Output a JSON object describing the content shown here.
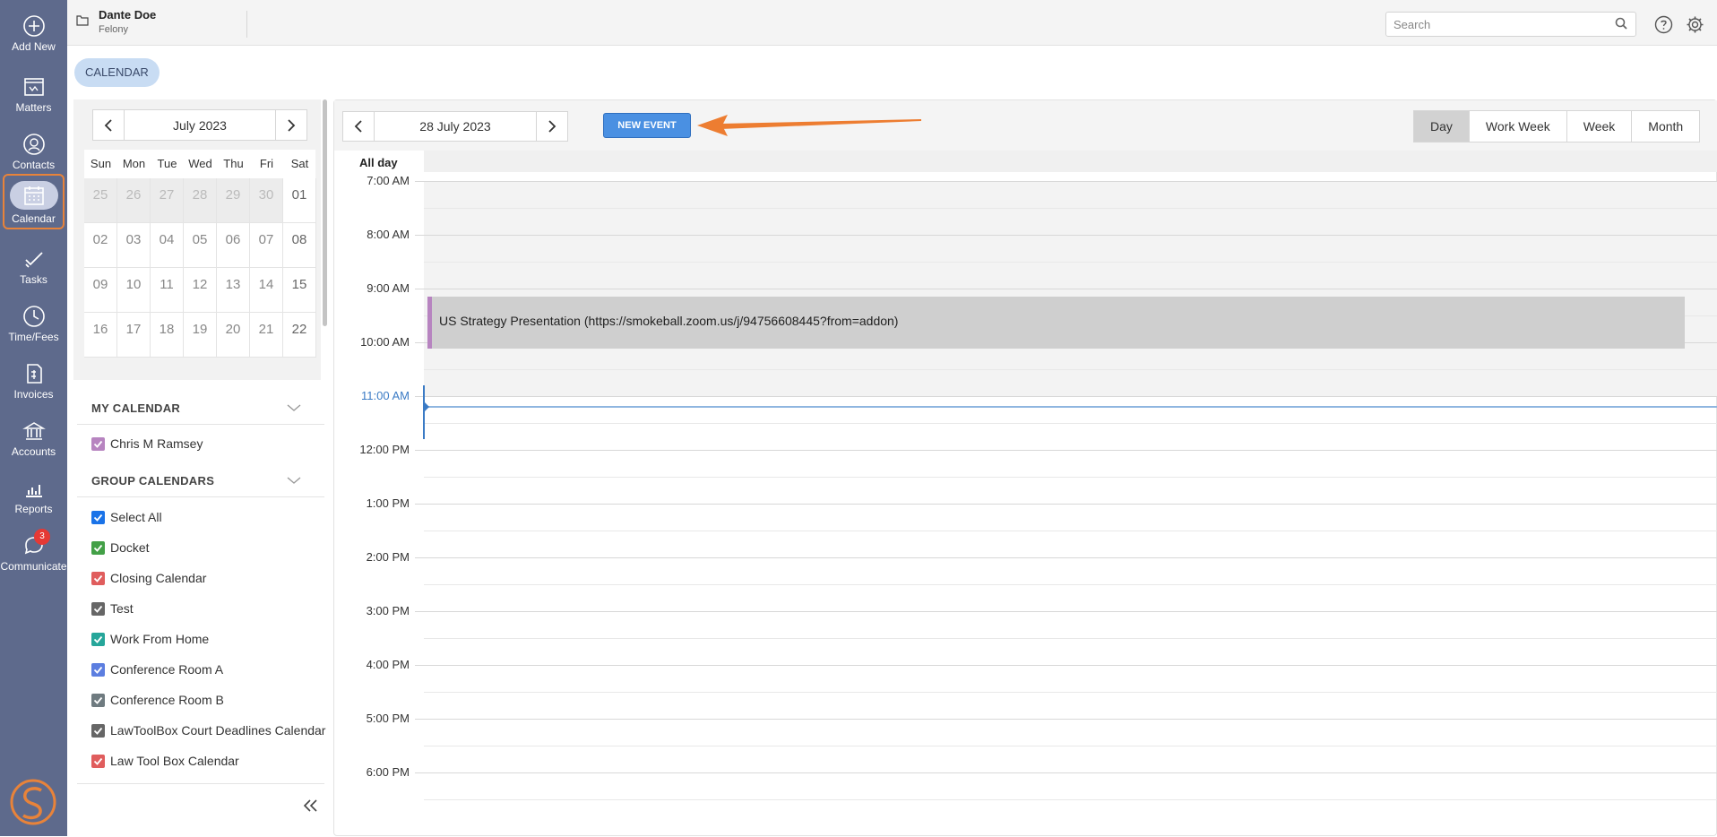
{
  "rail": {
    "items": [
      {
        "label": "Add New",
        "icon": "plus-circle-icon"
      },
      {
        "label": "Matters",
        "icon": "matters-icon"
      },
      {
        "label": "Contacts",
        "icon": "contacts-icon"
      },
      {
        "label": "Calendar",
        "icon": "calendar-icon",
        "active": true
      },
      {
        "label": "Tasks",
        "icon": "tasks-icon"
      },
      {
        "label": "Time/Fees",
        "icon": "clock-icon"
      },
      {
        "label": "Invoices",
        "icon": "invoice-icon"
      },
      {
        "label": "Accounts",
        "icon": "bank-icon"
      },
      {
        "label": "Reports",
        "icon": "bar-chart-icon"
      },
      {
        "label": "Communicate",
        "icon": "chat-icon",
        "badge": "3"
      }
    ],
    "logo": "smokeball-logo"
  },
  "header": {
    "matter_name": "Dante Doe",
    "matter_type": "Felony",
    "search_placeholder": "Search"
  },
  "page_tab": "CALENDAR",
  "mini_calendar": {
    "month": "July 2023",
    "weekdays": [
      "Sun",
      "Mon",
      "Tue",
      "Wed",
      "Thu",
      "Fri",
      "Sat"
    ],
    "weeks": [
      [
        {
          "d": "25",
          "out": true
        },
        {
          "d": "26",
          "out": true
        },
        {
          "d": "27",
          "out": true
        },
        {
          "d": "28",
          "out": true
        },
        {
          "d": "29",
          "out": true
        },
        {
          "d": "30",
          "out": true
        },
        {
          "d": "01",
          "out": false
        }
      ],
      [
        {
          "d": "02",
          "out": false
        },
        {
          "d": "03",
          "out": false
        },
        {
          "d": "04",
          "out": false
        },
        {
          "d": "05",
          "out": false
        },
        {
          "d": "06",
          "out": false
        },
        {
          "d": "07",
          "out": false
        },
        {
          "d": "08",
          "out": false
        }
      ],
      [
        {
          "d": "09",
          "out": false
        },
        {
          "d": "10",
          "out": false
        },
        {
          "d": "11",
          "out": false
        },
        {
          "d": "12",
          "out": false
        },
        {
          "d": "13",
          "out": false
        },
        {
          "d": "14",
          "out": false
        },
        {
          "d": "15",
          "out": false
        }
      ],
      [
        {
          "d": "16",
          "out": false
        },
        {
          "d": "17",
          "out": false
        },
        {
          "d": "18",
          "out": false
        },
        {
          "d": "19",
          "out": false
        },
        {
          "d": "20",
          "out": false
        },
        {
          "d": "21",
          "out": false
        },
        {
          "d": "22",
          "out": false
        }
      ]
    ]
  },
  "my_calendar": {
    "heading": "MY CALENDAR",
    "items": [
      {
        "label": "Chris M Ramsey",
        "color": "#b784c0"
      }
    ]
  },
  "group_calendars": {
    "heading": "GROUP CALENDARS",
    "items": [
      {
        "label": "Select All",
        "color": "#1a73e8"
      },
      {
        "label": "Docket",
        "color": "#43a047"
      },
      {
        "label": "Closing Calendar",
        "color": "#e05d5d"
      },
      {
        "label": "Test",
        "color": "#666666"
      },
      {
        "label": "Work From Home",
        "color": "#26a69a"
      },
      {
        "label": "Conference Room A",
        "color": "#5c7ee0"
      },
      {
        "label": "Conference Room B",
        "color": "#6f7b80"
      },
      {
        "label": "LawToolBox Court Deadlines Calendar",
        "color": "#666666"
      },
      {
        "label": "Law Tool Box Calendar",
        "color": "#e05d5d"
      }
    ]
  },
  "day_view": {
    "date": "28 July 2023",
    "new_event_label": "NEW EVENT",
    "views": [
      "Day",
      "Work Week",
      "Week",
      "Month"
    ],
    "active_view": "Day",
    "all_day_label": "All day",
    "hours": [
      "7:00 AM",
      "8:00 AM",
      "9:00 AM",
      "10:00 AM",
      "11:00 AM",
      "12:00 PM",
      "1:00 PM",
      "2:00 PM",
      "3:00 PM",
      "4:00 PM",
      "5:00 PM",
      "6:00 PM"
    ],
    "current_hour": "11:00 AM",
    "event": {
      "title": "US Strategy Presentation (https://smokeball.zoom.us/j/94756608445?from=addon)",
      "color": "#b784c0"
    }
  },
  "colors": {
    "rail": "#5e6a8c",
    "accent": "#4a90e2",
    "highlight": "#e8833a"
  }
}
